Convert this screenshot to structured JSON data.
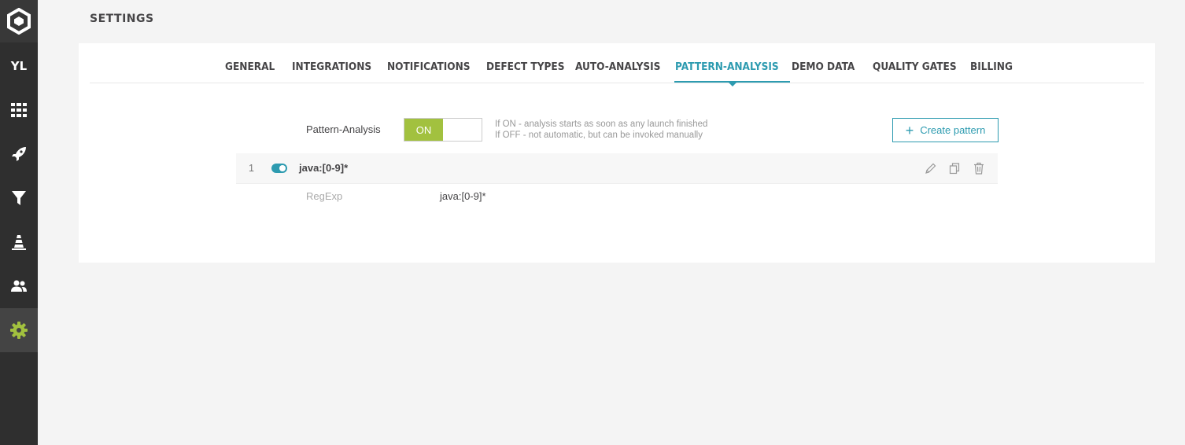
{
  "sidebar": {
    "project_label": "YL",
    "items": [
      {
        "name": "dashboard-icon"
      },
      {
        "name": "launches-icon"
      },
      {
        "name": "filters-icon"
      },
      {
        "name": "debug-icon"
      },
      {
        "name": "members-icon"
      },
      {
        "name": "settings-icon",
        "active": true
      }
    ],
    "active_icon_color": "#a2c13f"
  },
  "page": {
    "title": "SETTINGS"
  },
  "tabs": [
    {
      "label": "GENERAL"
    },
    {
      "label": "INTEGRATIONS"
    },
    {
      "label": "NOTIFICATIONS"
    },
    {
      "label": "DEFECT TYPES"
    },
    {
      "label": "AUTO-ANALYSIS"
    },
    {
      "label": "PATTERN-ANALYSIS",
      "active": true
    },
    {
      "label": "DEMO DATA"
    },
    {
      "label": "QUALITY GATES"
    },
    {
      "label": "BILLING"
    }
  ],
  "pattern_analysis": {
    "label": "Pattern-Analysis",
    "switch_state": "ON",
    "hint_line1": "If ON - analysis starts as soon as any launch finished",
    "hint_line2": "If OFF - not automatic, but can be invoked manually",
    "create_button": "Create pattern"
  },
  "patterns": [
    {
      "number": "1",
      "enabled": true,
      "name": "java:[0-9]*",
      "type_label": "RegExp",
      "value": "java:[0-9]*"
    }
  ],
  "colors": {
    "accent": "#2d9bb0",
    "switch_on": "#a2c13f",
    "sidebar_bg": "#2f2f2f"
  }
}
